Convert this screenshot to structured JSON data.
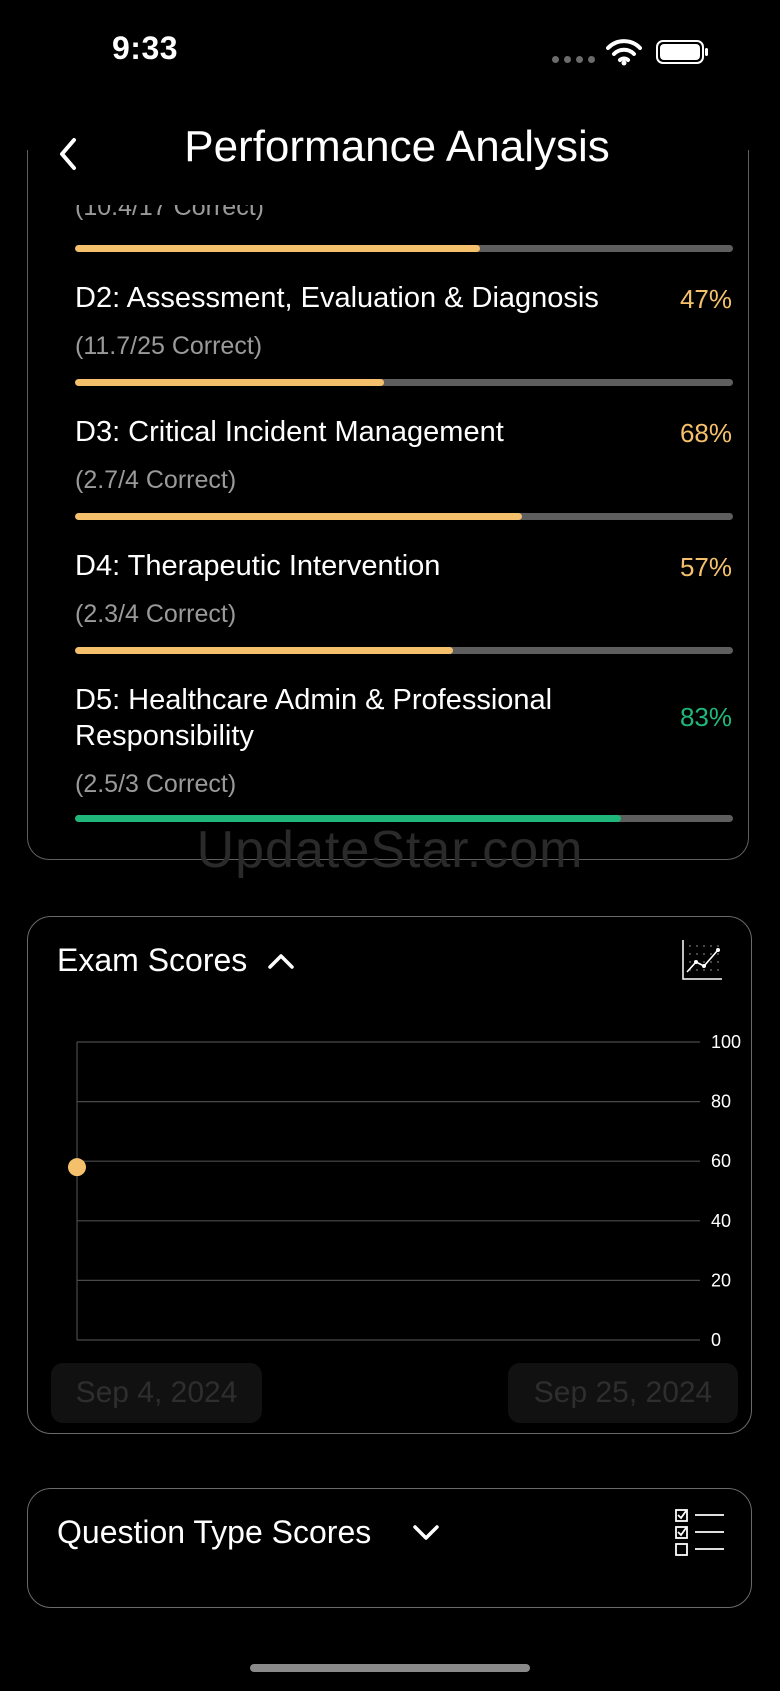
{
  "status": {
    "time": "9:33"
  },
  "header": {
    "title": "Performance Analysis"
  },
  "domains": [
    {
      "label": "",
      "sub": "(10.4/17 Correct)",
      "percent": "",
      "progress": 0.615,
      "color": "#f5c06b"
    },
    {
      "label": "D2: Assessment, Evaluation & Diagnosis",
      "sub": "(11.7/25 Correct)",
      "percent": "47%",
      "progress": 0.47,
      "color": "#f5c06b"
    },
    {
      "label": "D3: Critical Incident Management",
      "sub": "(2.7/4 Correct)",
      "percent": "68%",
      "progress": 0.68,
      "color": "#f5c06b"
    },
    {
      "label": "D4: Therapeutic Intervention",
      "sub": "(2.3/4 Correct)",
      "percent": "57%",
      "progress": 0.575,
      "color": "#f5c06b"
    },
    {
      "label": "D5: Healthcare Admin & Professional Responsibility",
      "sub": "(2.5/3 Correct)",
      "percent": "83%",
      "progress": 0.83,
      "color": "#1fb87a"
    }
  ],
  "watermark": "UpdateStar.com",
  "exam_scores": {
    "title": "Exam Scores",
    "start_date": "Sep 4, 2024",
    "end_date": "Sep 25, 2024"
  },
  "question_types": {
    "title": "Question Type Scores"
  },
  "colors": {
    "accent": "#f5c06b",
    "good": "#1fb87a",
    "track": "#5e5e5e",
    "border": "#6a6a6a"
  },
  "icons": [
    "back-chevron-icon",
    "chevron-up-icon",
    "chevron-down-icon",
    "line-chart-icon",
    "checklist-icon",
    "wifi-icon",
    "battery-icon",
    "signal-icon"
  ],
  "chart_data": {
    "type": "scatter",
    "title": "",
    "x": [
      "Sep 4, 2024"
    ],
    "y": [
      58
    ],
    "ylim": [
      0,
      100
    ],
    "yticks": [
      0,
      20,
      40,
      60,
      80,
      100
    ],
    "grid": true,
    "point_color": "#f5c06b"
  }
}
